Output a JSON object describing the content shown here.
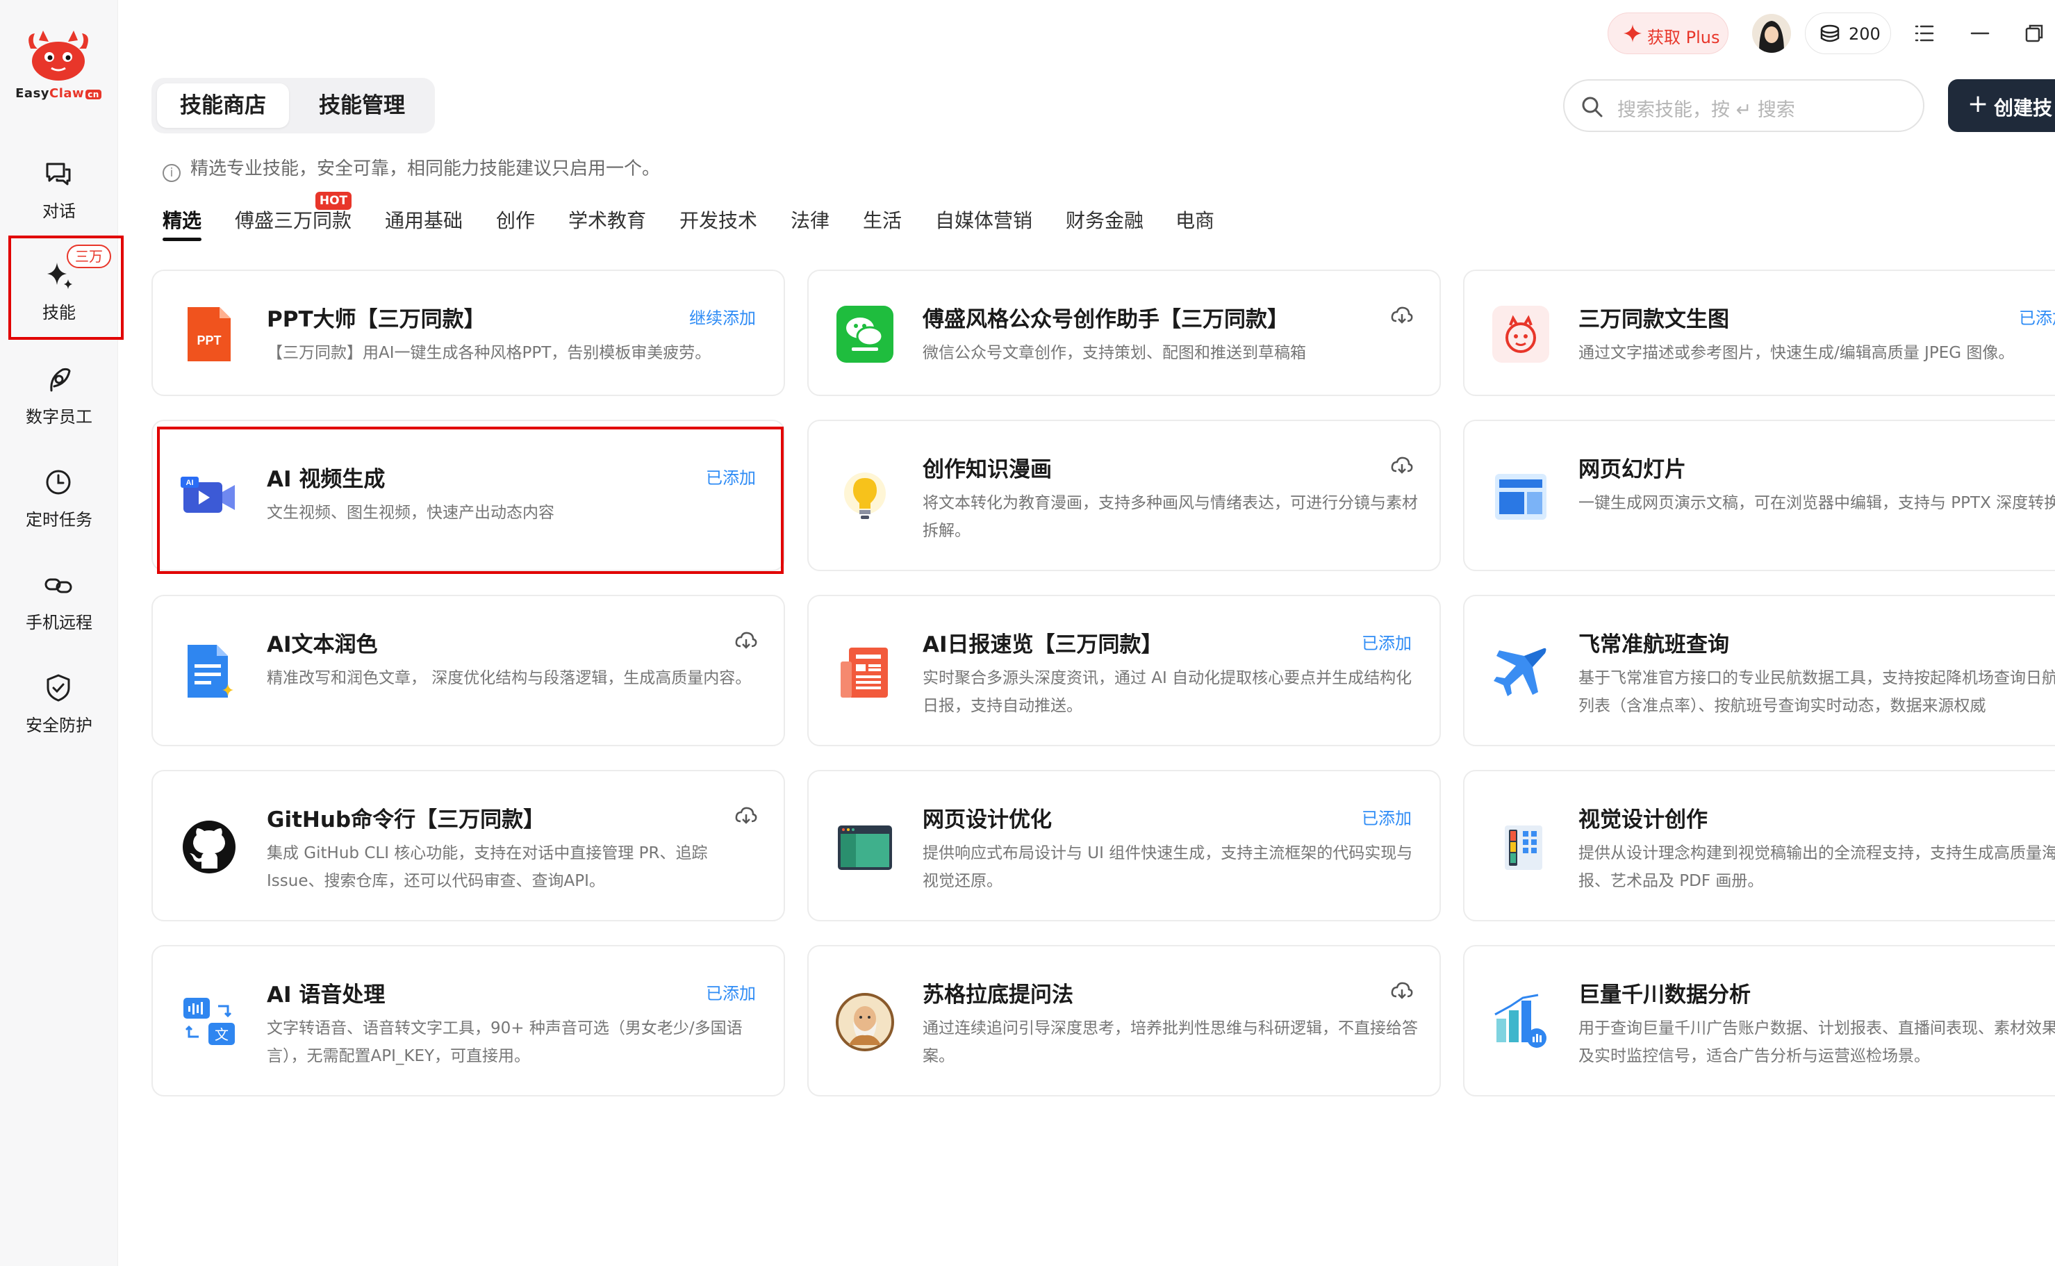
{
  "app": {
    "logo_text_easy": "Easy",
    "logo_text_claw": "Claw",
    "logo_text_cn": "cn"
  },
  "sidebar": {
    "badge": "三万",
    "items": [
      {
        "label": "对话",
        "icon": "chat-bubbles-icon"
      },
      {
        "label": "技能",
        "icon": "sparkle-icon",
        "active": true
      },
      {
        "label": "数字员工",
        "icon": "leaf-person-icon"
      },
      {
        "label": "定时任务",
        "icon": "clock-icon"
      },
      {
        "label": "手机远程",
        "icon": "link-chain-icon"
      },
      {
        "label": "安全防护",
        "icon": "shield-check-icon"
      }
    ]
  },
  "header": {
    "plus_label": "获取 Plus",
    "credits": "200",
    "search_placeholder": "搜索技能，按 ↵ 搜索",
    "create_label": "创建技"
  },
  "tabs": [
    {
      "label": "技能商店",
      "active": true
    },
    {
      "label": "技能管理",
      "active": false
    }
  ],
  "notice": "精选专业技能，安全可靠，相同能力技能建议只启用一个。",
  "categories": [
    {
      "label": "精选",
      "active": true
    },
    {
      "label": "傅盛三万同款",
      "hot": "HOT"
    },
    {
      "label": "通用基础"
    },
    {
      "label": "创作"
    },
    {
      "label": "学术教育"
    },
    {
      "label": "开发技术"
    },
    {
      "label": "法律"
    },
    {
      "label": "生活"
    },
    {
      "label": "自媒体营销"
    },
    {
      "label": "财务金融"
    },
    {
      "label": "电商"
    }
  ],
  "cards": [
    {
      "title": "PPT大师【三万同款】",
      "desc": "【三万同款】用AI一键生成各种风格PPT，告别模板审美疲劳。",
      "status": "继续添加",
      "icon": "ppt-file-icon"
    },
    {
      "title": "傅盛风格公众号创作助手【三万同款】",
      "desc": "微信公众号文章创作，支持策划、配图和推送到草稿箱",
      "status": "",
      "icon": "wechat-icon"
    },
    {
      "title": "三万同款文生图",
      "desc": "通过文字描述或参考图片，快速生成/编辑高质量 JPEG 图像。",
      "status": "已添加",
      "icon": "mascot-icon"
    },
    {
      "title": "AI 视频生成",
      "desc": "文生视频、图生视频，快速产出动态内容",
      "status": "已添加",
      "icon": "ai-video-icon"
    },
    {
      "title": "创作知识漫画",
      "desc": "将文本转化为教育漫画，支持多种画风与情绪表达，可进行分镜与素材拆解。",
      "status": "",
      "icon": "lightbulb-icon"
    },
    {
      "title": "网页幻灯片",
      "desc": "一键生成网页演示文稿，可在浏览器中编辑，支持与 PPTX 深度转换。",
      "status": "",
      "icon": "web-slides-icon"
    },
    {
      "title": "AI文本润色",
      "desc": "精准改写和润色文章， 深度优化结构与段落逻辑，生成高质量内容。",
      "status": "",
      "icon": "document-sparkle-icon"
    },
    {
      "title": "AI日报速览【三万同款】",
      "desc": "实时聚合多源头深度资讯，通过 AI 自动化提取核心要点并生成结构化日报，支持自动推送。",
      "status": "已添加",
      "icon": "newspaper-icon"
    },
    {
      "title": "飞常准航班查询",
      "desc": "基于飞常准官方接口的专业民航数据工具，支持按起降机场查询日航班列表（含准点率）、按航班号查询实时动态，数据来源权威",
      "status": "",
      "icon": "airplane-icon"
    },
    {
      "title": "GitHub命令行【三万同款】",
      "desc": "集成 GitHub CLI 核心功能，支持在对话中直接管理 PR、追踪 Issue、搜索仓库，还可以代码审查、查询API。",
      "status": "",
      "icon": "github-icon"
    },
    {
      "title": "网页设计优化",
      "desc": "提供响应式布局设计与 UI 组件快速生成，支持主流框架的代码实现与视觉还原。",
      "status": "已添加",
      "icon": "web-design-icon"
    },
    {
      "title": "视觉设计创作",
      "desc": "提供从设计理念构建到视觉稿输出的全流程支持，支持生成高质量海报、艺术品及 PDF 画册。",
      "status": "",
      "icon": "palette-icon"
    },
    {
      "title": "AI 语音处理",
      "desc": "文字转语音、语音转文字工具，90+ 种声音可选（男女老少/多国语言），无需配置API_KEY，可直接用。",
      "status": "已添加",
      "icon": "voice-translate-icon"
    },
    {
      "title": "苏格拉底提问法",
      "desc": "通过连续追问引导深度思考，培养批判性思维与科研逻辑，不直接给答案。",
      "status": "",
      "icon": "socrates-icon"
    },
    {
      "title": "巨量千川数据分析",
      "desc": "用于查询巨量千川广告账户数据、计划报表、直播间表现、素材效果以及实时监控信号，适合广告分析与运营巡检场景。",
      "status": "",
      "icon": "bar-analytics-icon"
    }
  ],
  "colors": {
    "accent": "#2f8cf5",
    "brand": "#e8362a",
    "highlight": "#e10000"
  }
}
